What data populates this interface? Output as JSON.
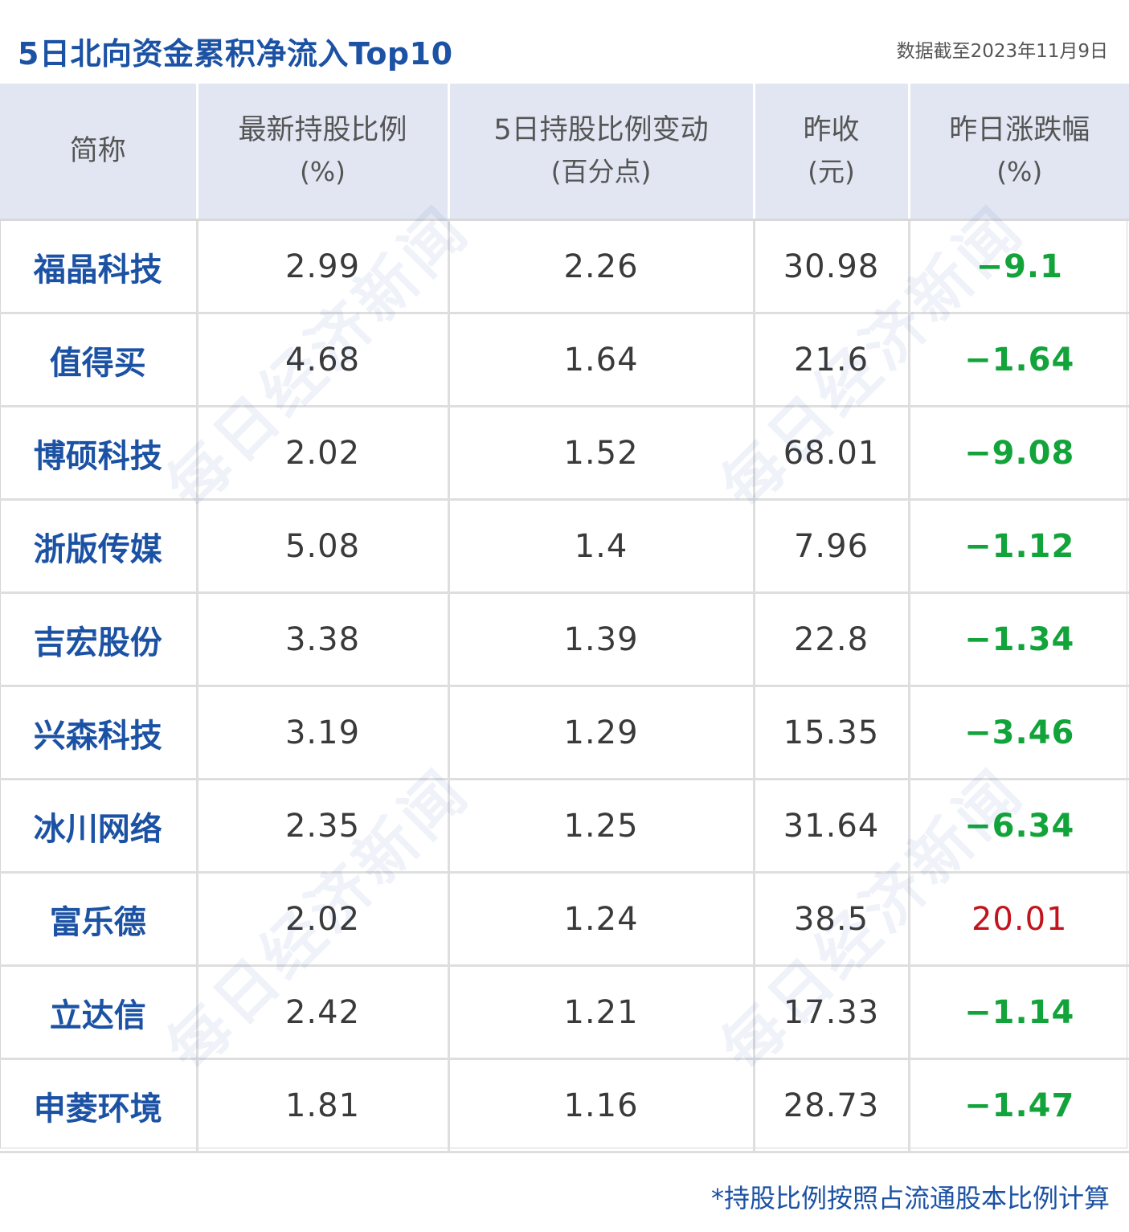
{
  "title": "5日北向资金累积净流入Top10",
  "as_of": "数据截至2023年11月9日",
  "footnote": "*持股比例按照占流通股本比例计算",
  "watermark": "每日经济新闻",
  "colors": {
    "brand": "#1c52a4",
    "header_bg": "#e1e6f2",
    "negative": "#12a43a",
    "positive": "#c2141c"
  },
  "chart_data": {
    "type": "table",
    "columns": [
      {
        "label": "简称",
        "unit": ""
      },
      {
        "label": "最新持股比例",
        "unit": "(%)"
      },
      {
        "label": "5日持股比例变动",
        "unit": "(百分点)"
      },
      {
        "label": "昨收",
        "unit": "(元)"
      },
      {
        "label": "昨日涨跌幅",
        "unit": "(%)"
      }
    ],
    "rows": [
      {
        "name": "福晶科技",
        "holding": "2.99",
        "change_5d": "2.26",
        "close": "30.98",
        "pct": "−9.1",
        "dir": "neg"
      },
      {
        "name": "值得买",
        "holding": "4.68",
        "change_5d": "1.64",
        "close": "21.6",
        "pct": "−1.64",
        "dir": "neg"
      },
      {
        "name": "博硕科技",
        "holding": "2.02",
        "change_5d": "1.52",
        "close": "68.01",
        "pct": "−9.08",
        "dir": "neg"
      },
      {
        "name": "浙版传媒",
        "holding": "5.08",
        "change_5d": "1.4",
        "close": "7.96",
        "pct": "−1.12",
        "dir": "neg"
      },
      {
        "name": "吉宏股份",
        "holding": "3.38",
        "change_5d": "1.39",
        "close": "22.8",
        "pct": "−1.34",
        "dir": "neg"
      },
      {
        "name": "兴森科技",
        "holding": "3.19",
        "change_5d": "1.29",
        "close": "15.35",
        "pct": "−3.46",
        "dir": "neg"
      },
      {
        "name": "冰川网络",
        "holding": "2.35",
        "change_5d": "1.25",
        "close": "31.64",
        "pct": "−6.34",
        "dir": "neg"
      },
      {
        "name": "富乐德",
        "holding": "2.02",
        "change_5d": "1.24",
        "close": "38.5",
        "pct": "20.01",
        "dir": "pos"
      },
      {
        "name": "立达信",
        "holding": "2.42",
        "change_5d": "1.21",
        "close": "17.33",
        "pct": "−1.14",
        "dir": "neg"
      },
      {
        "name": "申菱环境",
        "holding": "1.81",
        "change_5d": "1.16",
        "close": "28.73",
        "pct": "−1.47",
        "dir": "neg"
      }
    ]
  }
}
